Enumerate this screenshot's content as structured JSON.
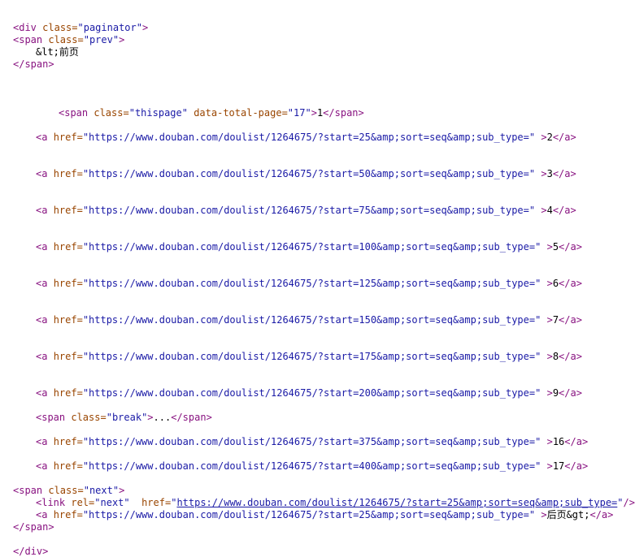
{
  "source": {
    "div_open": {
      "tag_open": "<div",
      "attr": "class=",
      "val": "\"paginator\"",
      "close": ">"
    },
    "prev": {
      "tag_open": "<span",
      "attr": "class=",
      "val": "\"prev\"",
      "close": ">",
      "text": "&lt;前页",
      "end_tag": "</span>"
    },
    "thispage": {
      "tag_open": "<span",
      "attr1": "class=",
      "val1": "\"thispage\"",
      "attr2": "data-total-page=",
      "val2": "\"17\"",
      "close": ">",
      "text": "1",
      "end_tag": "</span>"
    },
    "a_open": "<a",
    "href_attr": "href=",
    "a_end": "</a>",
    "page_links": [
      {
        "url": "\"https://www.douban.com/doulist/1264675/?start=25&amp;sort=seq&amp;sub_type=\"",
        "text": "2"
      },
      {
        "url": "\"https://www.douban.com/doulist/1264675/?start=50&amp;sort=seq&amp;sub_type=\"",
        "text": "3"
      },
      {
        "url": "\"https://www.douban.com/doulist/1264675/?start=75&amp;sort=seq&amp;sub_type=\"",
        "text": "4"
      },
      {
        "url": "\"https://www.douban.com/doulist/1264675/?start=100&amp;sort=seq&amp;sub_type=\"",
        "text": "5"
      },
      {
        "url": "\"https://www.douban.com/doulist/1264675/?start=125&amp;sort=seq&amp;sub_type=\"",
        "text": "6"
      },
      {
        "url": "\"https://www.douban.com/doulist/1264675/?start=150&amp;sort=seq&amp;sub_type=\"",
        "text": "7"
      },
      {
        "url": "\"https://www.douban.com/doulist/1264675/?start=175&amp;sort=seq&amp;sub_type=\"",
        "text": "8"
      },
      {
        "url": "\"https://www.douban.com/doulist/1264675/?start=200&amp;sort=seq&amp;sub_type=\"",
        "text": "9"
      }
    ],
    "break_span": {
      "tag_open": "<span",
      "attr": "class=",
      "val": "\"break\"",
      "close": ">",
      "text": "...",
      "end_tag": "</span>"
    },
    "tail_links": [
      {
        "url": "\"https://www.douban.com/doulist/1264675/?start=375&amp;sort=seq&amp;sub_type=\"",
        "text": "16"
      },
      {
        "url": "\"https://www.douban.com/doulist/1264675/?start=400&amp;sort=seq&amp;sub_type=\"",
        "text": "17"
      }
    ],
    "next": {
      "tag_open": "<span",
      "attr": "class=",
      "val": "\"next\"",
      "close": ">",
      "link_tag": {
        "open": "<link",
        "rel_attr": "rel=",
        "rel_val": "\"next\"",
        "href_attr": "href=",
        "q1": "\"",
        "href_url": "https://www.douban.com/doulist/1264675/?start=25&amp;sort=seq&amp;sub_type=",
        "q2": "\"",
        "close": "/>"
      },
      "anchor": {
        "url": "\"https://www.douban.com/doulist/1264675/?start=25&amp;sort=seq&amp;sub_type=\"",
        "text": "后页&gt;"
      },
      "end_tag": "</span>"
    },
    "div_close": "</div>",
    "gt": ">",
    "sp": " "
  },
  "colors": {
    "tag": "#881280",
    "attribute": "#994500",
    "value": "#1a1aa6",
    "text": "#000000"
  }
}
